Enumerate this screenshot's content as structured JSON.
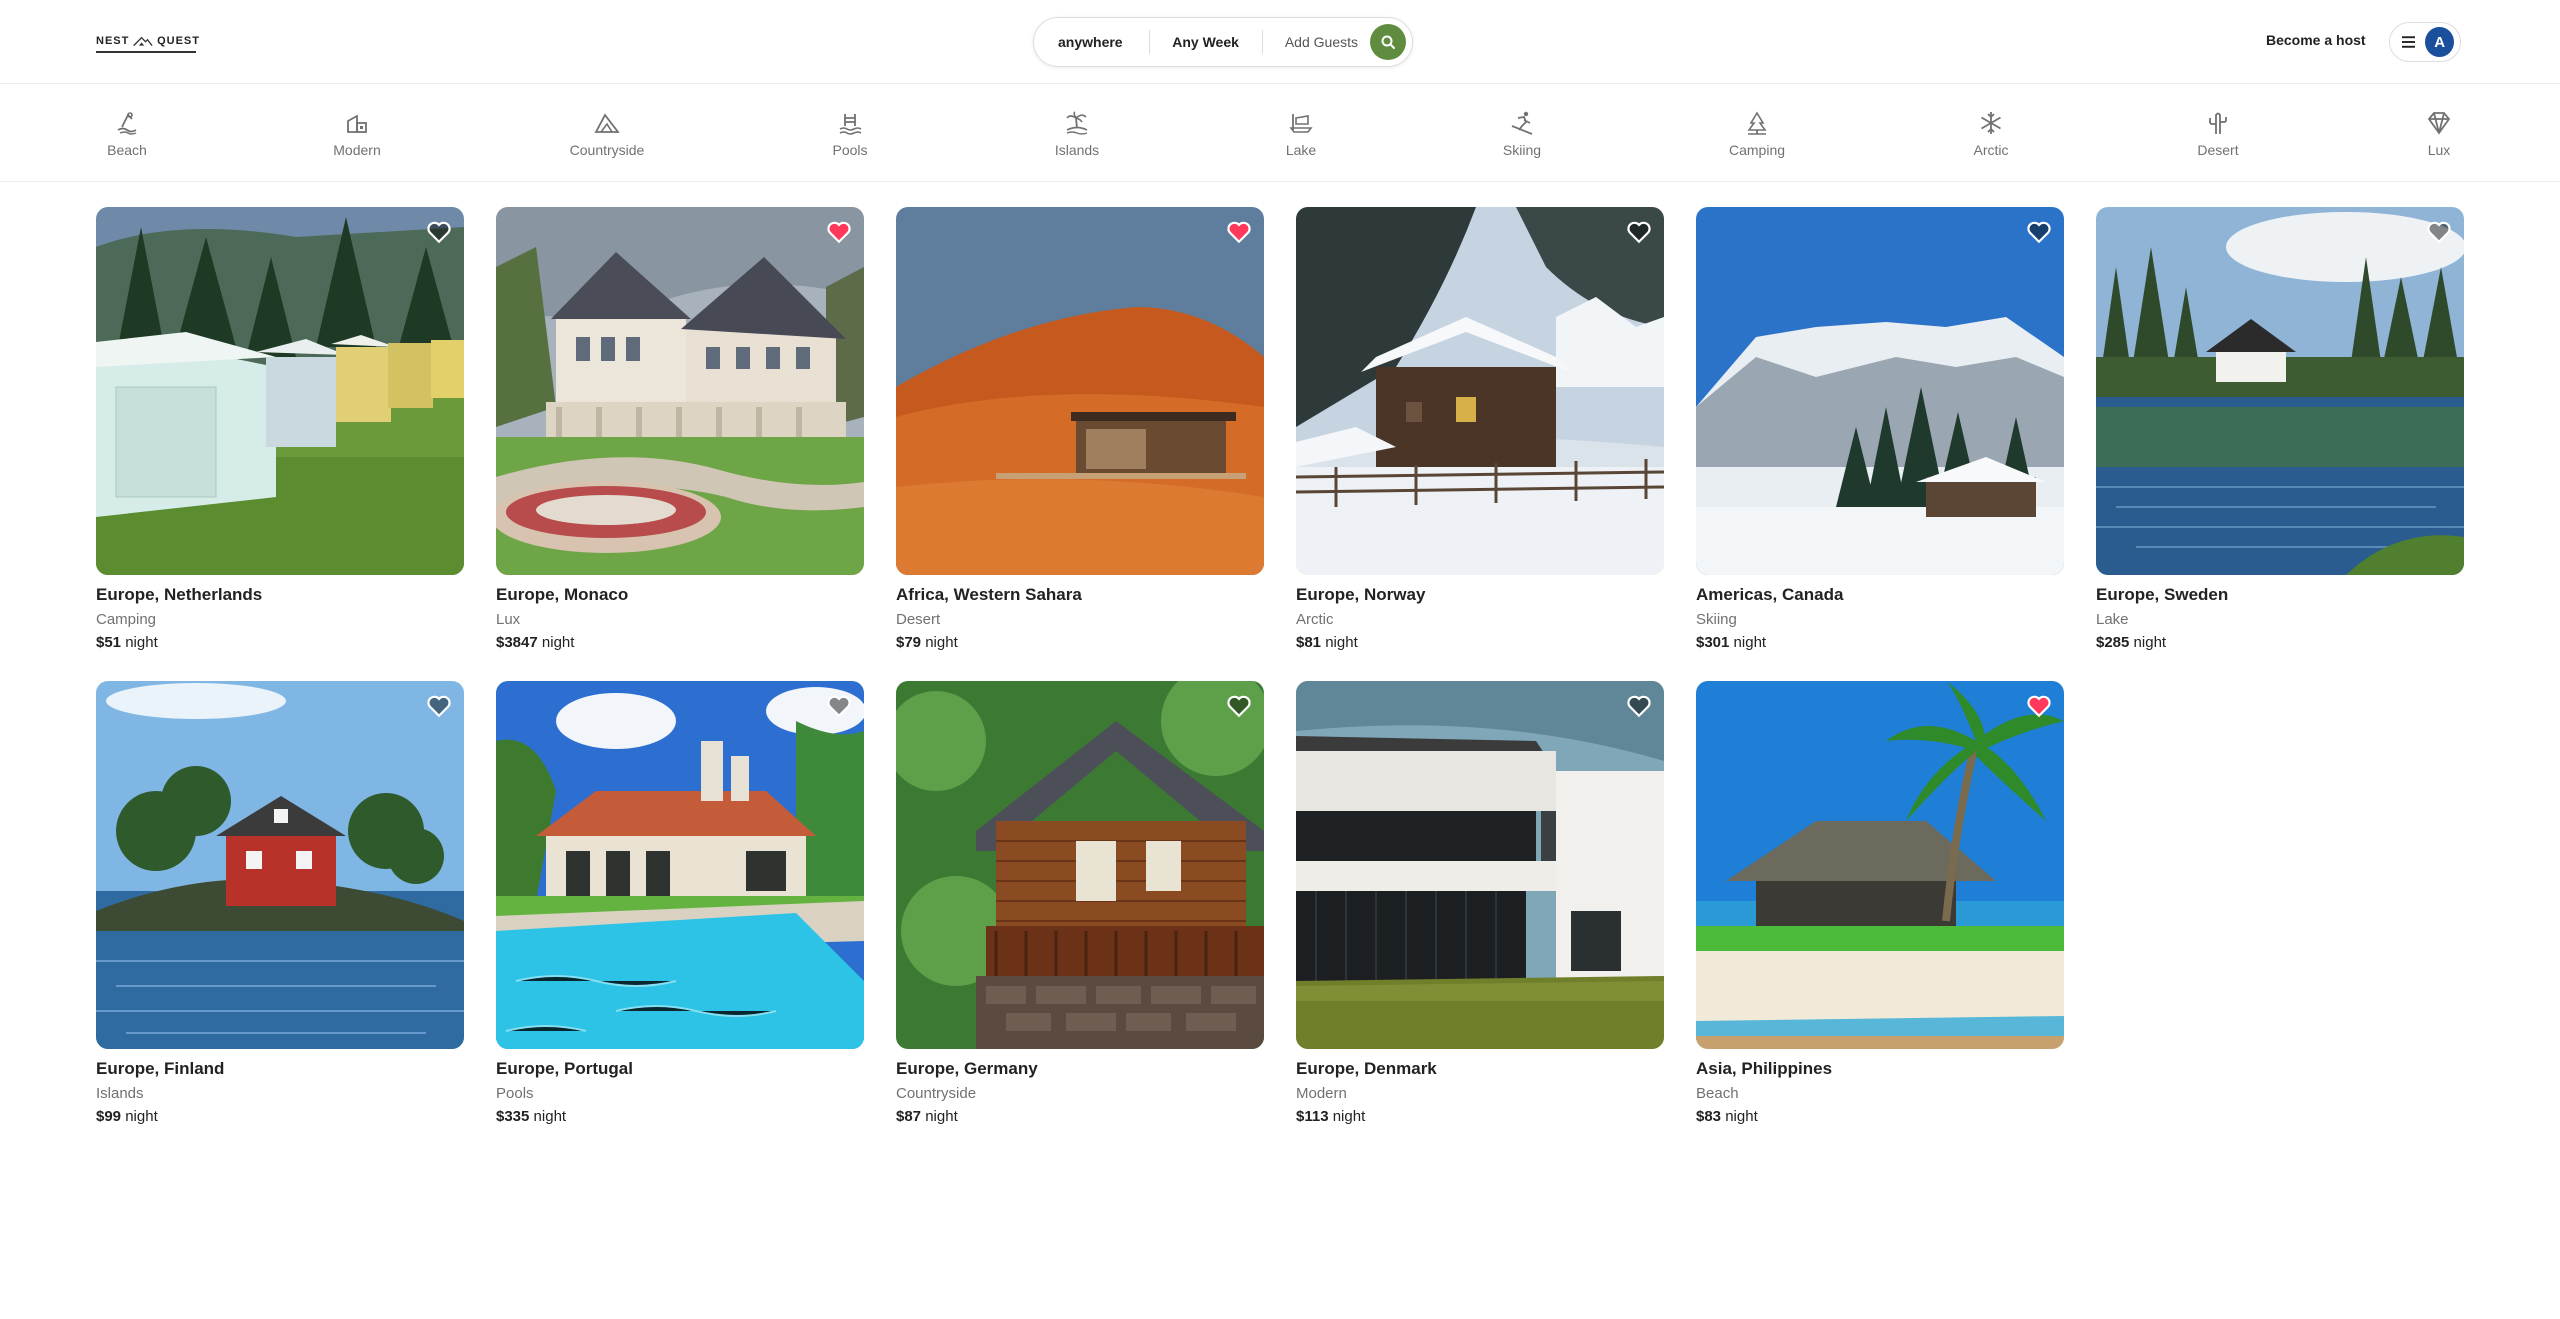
{
  "brand": {
    "word1": "NEST",
    "word2": "QUEST"
  },
  "search": {
    "where": "anywhere",
    "week": "Any Week",
    "guests": "Add Guests"
  },
  "header": {
    "host_label": "Become a host",
    "avatar_initial": "A"
  },
  "colors": {
    "accent": "#5f8c3f",
    "favorite": "#ff385c",
    "avatar": "#1a4f9c"
  },
  "categories": [
    {
      "label": "Beach",
      "icon": "beach-icon"
    },
    {
      "label": "Modern",
      "icon": "modern-house-icon"
    },
    {
      "label": "Countryside",
      "icon": "mountain-icon"
    },
    {
      "label": "Pools",
      "icon": "pool-icon"
    },
    {
      "label": "Islands",
      "icon": "island-icon"
    },
    {
      "label": "Lake",
      "icon": "boat-icon"
    },
    {
      "label": "Skiing",
      "icon": "ski-icon"
    },
    {
      "label": "Camping",
      "icon": "tree-icon"
    },
    {
      "label": "Arctic",
      "icon": "snowflake-icon"
    },
    {
      "label": "Desert",
      "icon": "cactus-icon"
    },
    {
      "label": "Lux",
      "icon": "diamond-icon"
    }
  ],
  "listings": [
    {
      "location": "Europe, Netherlands",
      "category": "Camping",
      "price": "$51",
      "unit": "night",
      "favorite": false
    },
    {
      "location": "Europe, Monaco",
      "category": "Lux",
      "price": "$3847",
      "unit": "night",
      "favorite": true
    },
    {
      "location": "Africa, Western Sahara",
      "category": "Desert",
      "price": "$79",
      "unit": "night",
      "favorite": true
    },
    {
      "location": "Europe, Norway",
      "category": "Arctic",
      "price": "$81",
      "unit": "night",
      "favorite": false
    },
    {
      "location": "Americas, Canada",
      "category": "Skiing",
      "price": "$301",
      "unit": "night",
      "favorite": false
    },
    {
      "location": "Europe, Sweden",
      "category": "Lake",
      "price": "$285",
      "unit": "night",
      "favorite": false
    },
    {
      "location": "Europe, Finland",
      "category": "Islands",
      "price": "$99",
      "unit": "night",
      "favorite": false
    },
    {
      "location": "Europe, Portugal",
      "category": "Pools",
      "price": "$335",
      "unit": "night",
      "favorite": false
    },
    {
      "location": "Europe, Germany",
      "category": "Countryside",
      "price": "$87",
      "unit": "night",
      "favorite": false
    },
    {
      "location": "Europe, Denmark",
      "category": "Modern",
      "price": "$113",
      "unit": "night",
      "favorite": false
    },
    {
      "location": "Asia, Philippines",
      "category": "Beach",
      "price": "$83",
      "unit": "night",
      "favorite": true
    }
  ]
}
